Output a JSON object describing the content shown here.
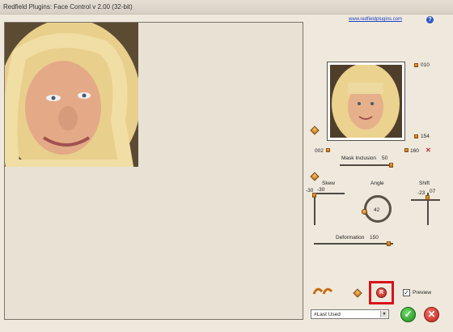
{
  "window": {
    "title": "Redfield Plugins: Face Control v 2.00 (32-bit)"
  },
  "header": {
    "link_text": "www.redfieldplugins.com",
    "help_icon": "question-icon"
  },
  "thumbnail": {
    "top_value": "010",
    "bottom_value": "154",
    "left_value": "002",
    "right_value": "160"
  },
  "mask_inclusion": {
    "label": "Mask Inclusion",
    "value": "50"
  },
  "skew": {
    "label": "Skew",
    "min_label": "-30",
    "value": "-30"
  },
  "angle": {
    "label": "Angle",
    "value": "42"
  },
  "shift": {
    "label": "Shift",
    "min_label": "-23",
    "value": "07"
  },
  "deformation": {
    "label": "Deformation",
    "value": "150"
  },
  "bottom": {
    "preview_label": "Preview",
    "preview_checked": true,
    "preset_value": "#Last Used",
    "reset_glyph": "R"
  },
  "colors": {
    "accent": "#c97113",
    "ok": "#1f8a1b",
    "cancel": "#c1271d",
    "highlight": "#d6141a"
  }
}
